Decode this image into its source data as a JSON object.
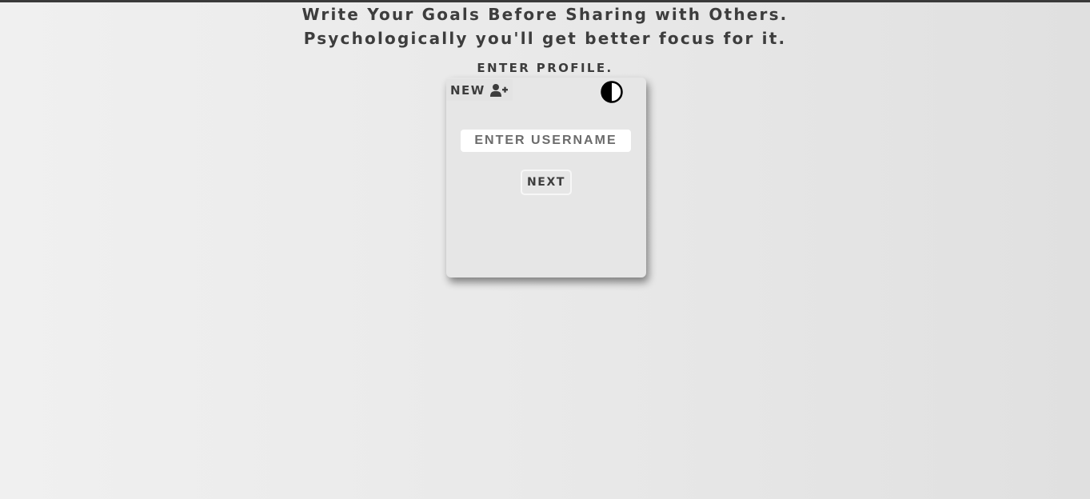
{
  "header": {
    "line1": "Write Your Goals Before Sharing with Others.",
    "line2": "Psychologically you'll get better focus for it.",
    "section_label": "ENTER PROFILE."
  },
  "card": {
    "new_button": {
      "label": "NEW",
      "icon": "user-plus-icon"
    },
    "theme_toggle": {
      "icon": "contrast-icon"
    },
    "username": {
      "value": "",
      "placeholder": "ENTER USERNAME"
    },
    "next_button": {
      "label": "NEXT"
    }
  },
  "colors": {
    "background": "#e9e9e9",
    "card": "#e6e6e6",
    "text": "#3d3d3d",
    "top_bar": "#3a3a3a"
  }
}
